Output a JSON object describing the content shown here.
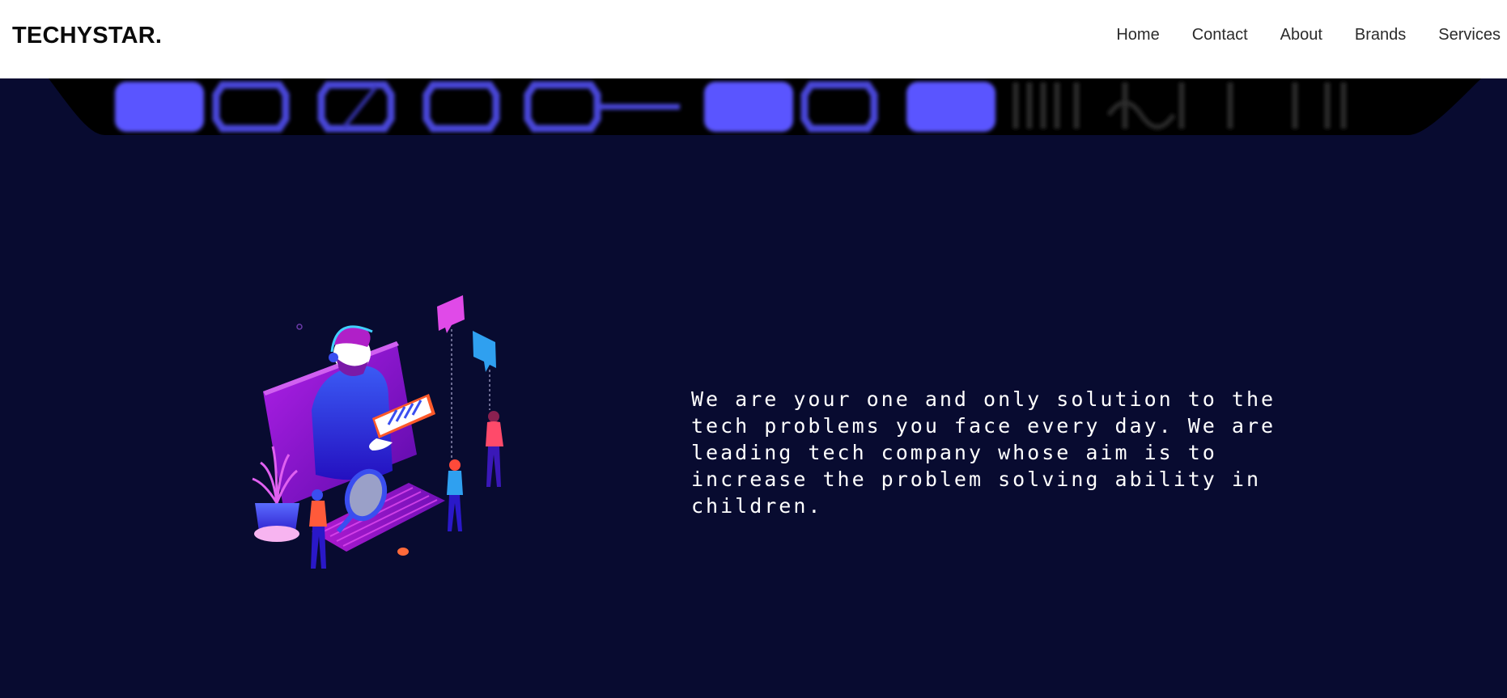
{
  "header": {
    "brand": "TECHYSTAR.",
    "nav": [
      {
        "label": "Home"
      },
      {
        "label": "Contact"
      },
      {
        "label": "About"
      },
      {
        "label": "Brands"
      },
      {
        "label": "Services"
      }
    ]
  },
  "hero": {
    "intro_text": "We are your one and only solution to the tech problems you face every day. We are leading tech company whose aim is to increase the problem solving ability in children."
  },
  "colors": {
    "page_background": "#080b30",
    "header_background": "#ffffff",
    "banner_accent": "#5a55ff",
    "illustration_purple": "#8a16c8",
    "illustration_pink": "#e040e8",
    "illustration_blue": "#3a4ef0"
  },
  "icons": [
    "support-agent-illustration"
  ]
}
